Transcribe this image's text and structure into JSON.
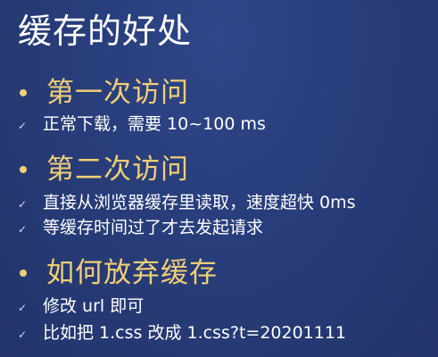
{
  "slide": {
    "title": "缓存的好处",
    "sections": [
      {
        "heading": "第一次访问",
        "items": [
          "正常下载，需要 10~100 ms"
        ]
      },
      {
        "heading": "第二次访问",
        "items": [
          "直接从浏览器缓存里读取，速度超快 0ms",
          "等缓存时间过了才去发起请求"
        ]
      },
      {
        "heading": "如何放弃缓存",
        "items": [
          "修改 url 即可",
          "比如把 1.css 改成 1.css?t=20201111"
        ]
      }
    ],
    "check_glyph": "✓",
    "colors": {
      "background": "#283d7a",
      "heading": "#f1cf76",
      "text": "#ffffff"
    }
  }
}
